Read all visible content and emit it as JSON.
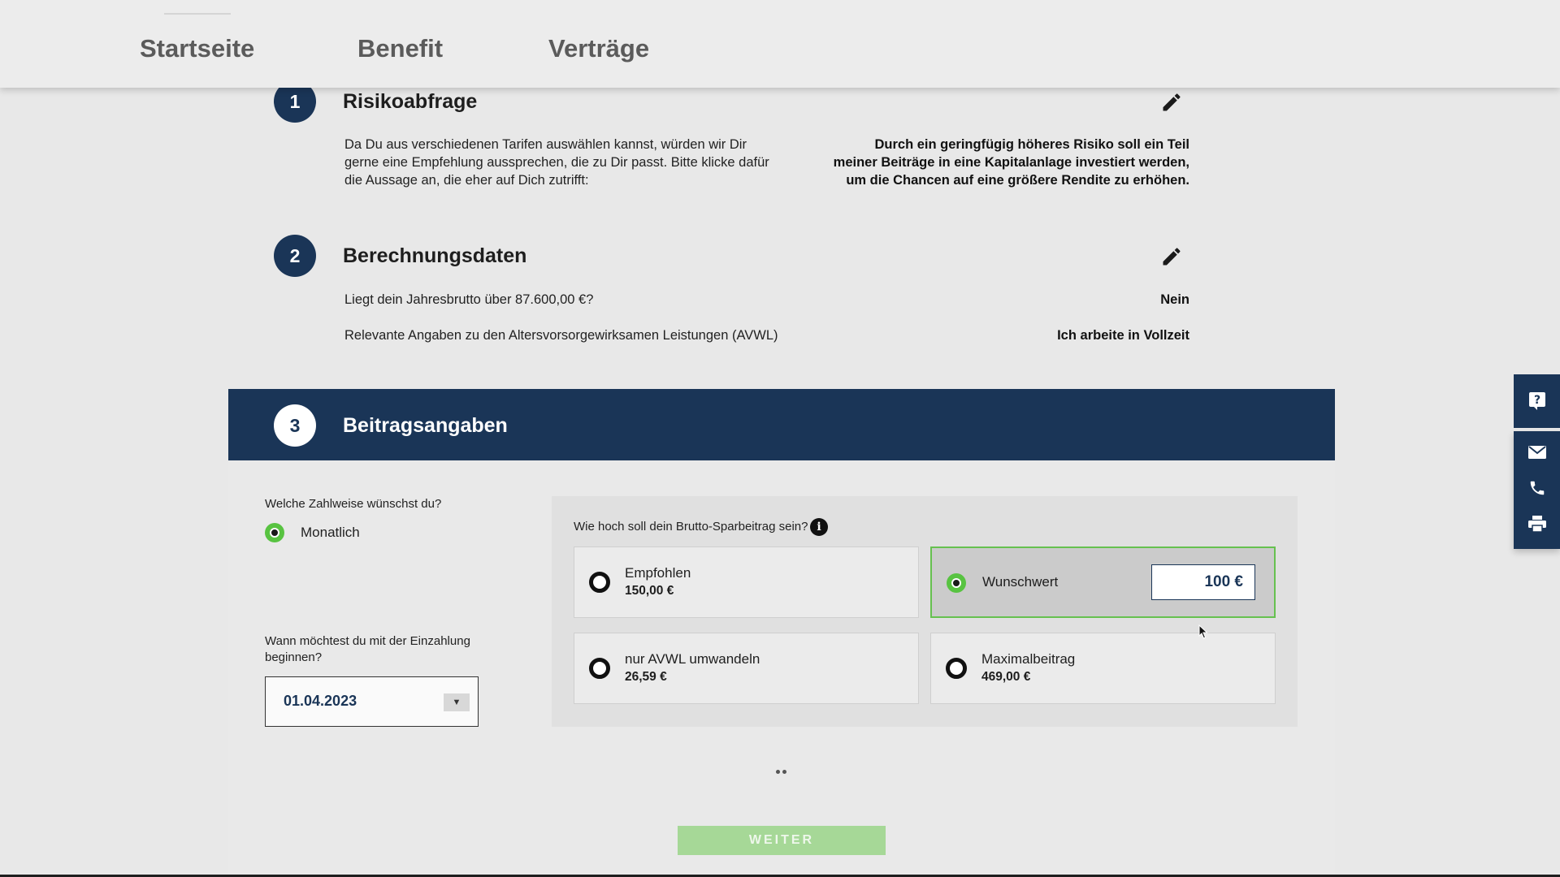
{
  "nav": {
    "items": [
      "Startseite",
      "Benefit",
      "Verträge"
    ]
  },
  "step1": {
    "number": "1",
    "title": "Risikoabfrage",
    "question": "Da Du aus verschiedenen Tarifen auswählen kannst, würden wir Dir gerne eine Empfehlung aussprechen, die zu Dir passt. Bitte klicke dafür die Aussage an, die eher auf Dich zutrifft:",
    "answer": "Durch ein geringfügig höheres Risiko soll ein Teil meiner Beiträge in eine Kapitalanlage investiert werden, um die Chancen auf eine größere Rendite zu erhöhen."
  },
  "step2": {
    "number": "2",
    "title": "Berechnungsdaten",
    "rows": [
      {
        "question": "Liegt dein Jahresbrutto über 87.600,00 €?",
        "answer": "Nein"
      },
      {
        "question": "Relevante Angaben zu den Altersvorsorgewirksamen Leistungen (AVWL)",
        "answer": "Ich arbeite in Vollzeit"
      }
    ]
  },
  "step3": {
    "number": "3",
    "title": "Beitragsangaben",
    "payment_question": "Welche Zahlweise wünschst du?",
    "payment_option": "Monatlich",
    "start_question": "Wann möchtest du mit der Einzahlung beginnen?",
    "start_date": "01.04.2023",
    "amount_question": "Wie hoch soll dein Brutto-Sparbeitrag sein?",
    "options": {
      "empfohlen": {
        "title": "Empfohlen",
        "value": "150,00 €"
      },
      "wunschwert": {
        "title": "Wunschwert",
        "input_value": "100 €"
      },
      "avwl": {
        "title": "nur AVWL umwandeln",
        "value": "26,59 €"
      },
      "maximal": {
        "title": "Maximalbeitrag",
        "value": "469,00 €"
      }
    },
    "selected_option": "Wunschwert",
    "next_button": "WEITER"
  },
  "sidebar_icons": [
    "question-icon",
    "mail-icon",
    "phone-icon",
    "print-icon"
  ],
  "colors": {
    "navy": "#1a3557",
    "green": "#58c341",
    "button_disabled": "#a6d897"
  }
}
